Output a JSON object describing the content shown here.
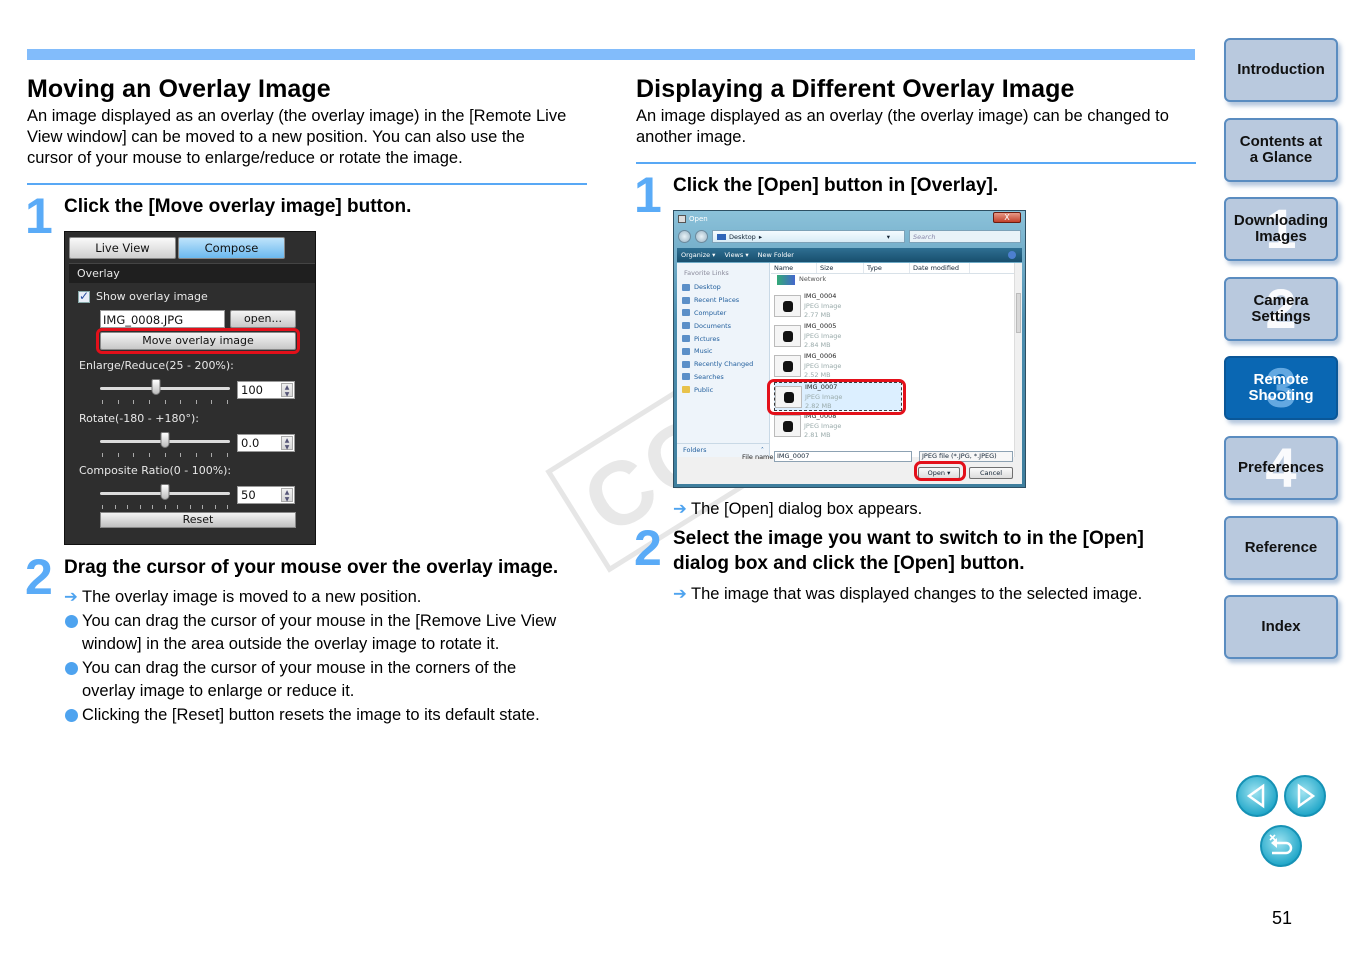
{
  "left": {
    "title": "Moving an Overlay Image",
    "intro": "An image displayed as an overlay (the overlay image) in the [Remote Live View window] can be moved to a new position. You can also use the cursor of your mouse to enlarge/reduce or rotate the image.",
    "steps": [
      {
        "num": "1",
        "title": "Click the [Move overlay image] button."
      },
      {
        "num": "2",
        "title": "Drag the cursor of your mouse over the overlay image."
      }
    ],
    "results": [
      {
        "marker": "➔",
        "text": "The overlay image is moved to a new position."
      },
      {
        "marker": "dot",
        "text": "You can drag the cursor of your mouse in the [Remove Live View window] in the area outside the overlay image to rotate it."
      },
      {
        "marker": "dot",
        "text": "You can drag the cursor of your mouse in the corners of the overlay image to enlarge or reduce it."
      },
      {
        "marker": "dot",
        "text": "Clicking the [Reset] button resets the image to its default state."
      }
    ]
  },
  "panel": {
    "tabs": [
      "Live View",
      "Compose"
    ],
    "active_tab": "Compose",
    "section": "Overlay",
    "show_overlay_label": "Show overlay image",
    "show_overlay_checked": true,
    "file_name": "IMG_0008.JPG",
    "open_label": "open...",
    "move_label": "Move overlay image",
    "sliders": [
      {
        "label": "Enlarge/Reduce(25 - 200%):",
        "value": "100",
        "fraction": 0.43
      },
      {
        "label": "Rotate(-180 - +180°):",
        "value": "0.0",
        "fraction": 0.5
      },
      {
        "label": "Composite Ratio(0 - 100%):",
        "value": "50",
        "fraction": 0.5
      }
    ],
    "reset_label": "Reset"
  },
  "right": {
    "title": "Displaying a Different Overlay Image",
    "intro": "An image displayed as an overlay (the overlay image) can be changed to another image.",
    "steps": [
      {
        "num": "1",
        "title": "Click the [Open] button in [Overlay]."
      },
      {
        "num": "2",
        "title": "Select the image you want to switch to in the [Open] dialog box and click the [Open] button."
      }
    ],
    "result1": "The [Open] dialog box appears.",
    "result2": "The image that was displayed changes to the selected image.",
    "arrow": "➔"
  },
  "dialog": {
    "title": "Open",
    "close": "X",
    "address": "Desktop",
    "search_placeholder": "Search",
    "toolbar": [
      "Organize ▾",
      "Views ▾",
      "New Folder"
    ],
    "favorites_header": "Favorite Links",
    "favorites": [
      "Desktop",
      "Recent Places",
      "Computer",
      "Documents",
      "Pictures",
      "Music",
      "Recently Changed",
      "Searches",
      "Public"
    ],
    "folders_label": "Folders",
    "columns": [
      "Name",
      "Size",
      "Type",
      "Date modified"
    ],
    "network_label": "Network",
    "files": [
      {
        "name": "IMG_0004",
        "type": "JPEG Image",
        "size": "2.77 MB"
      },
      {
        "name": "IMG_0005",
        "type": "JPEG Image",
        "size": "2.84 MB"
      },
      {
        "name": "IMG_0006",
        "type": "JPEG Image",
        "size": "2.52 MB"
      },
      {
        "name": "IMG_0007",
        "type": "JPEG Image",
        "size": "2.82 MB",
        "selected": true
      },
      {
        "name": "IMG_0008",
        "type": "JPEG Image",
        "size": "2.81 MB"
      }
    ],
    "filename_label": "File name:",
    "filename_value": "IMG_0007",
    "filetype": "JPEG file (*.JPG, *.JPEG)",
    "open_label": "Open",
    "cancel_label": "Cancel"
  },
  "watermark": "COPY",
  "sidebar": [
    {
      "label": "Introduction",
      "num": "",
      "active": false
    },
    {
      "label": "Contents at\na Glance",
      "num": "",
      "active": false
    },
    {
      "label": "Downloading\nImages",
      "num": "1",
      "active": false
    },
    {
      "label": "Camera\nSettings",
      "num": "2",
      "active": false
    },
    {
      "label": "Remote\nShooting",
      "num": "3",
      "active": true
    },
    {
      "label": "Preferences",
      "num": "4",
      "active": false
    },
    {
      "label": "Reference",
      "num": "",
      "active": false
    },
    {
      "label": "Index",
      "num": "",
      "active": false
    }
  ],
  "page_nav": {
    "prev": "◁",
    "next": "▷",
    "return": "↩"
  },
  "page_number": "51",
  "colors": {
    "accent": "#5aabf7",
    "highlight": "#e3101a",
    "nav_active": "#0a67b3",
    "nav_idle": "#b9c9de"
  }
}
